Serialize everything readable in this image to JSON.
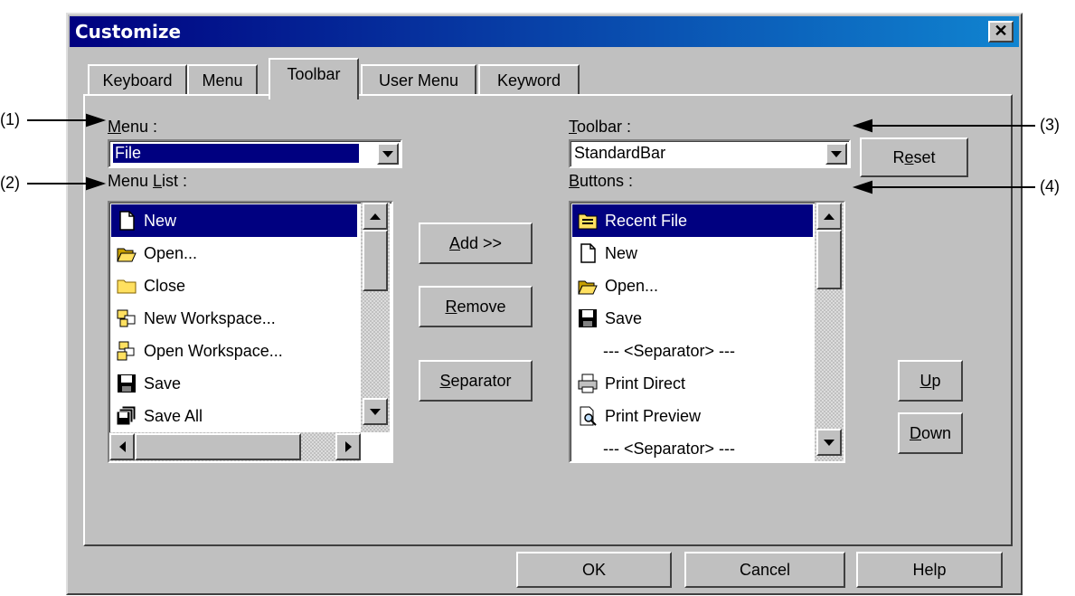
{
  "dialog": {
    "title": "Customize",
    "close_glyph": "✕"
  },
  "tabs": [
    {
      "label": "Keyboard",
      "active": false
    },
    {
      "label": "Menu",
      "active": false
    },
    {
      "label": "Toolbar",
      "active": true
    },
    {
      "label": "User Menu",
      "active": false
    },
    {
      "label": "Keyword",
      "active": false
    }
  ],
  "left": {
    "menu_label_mn": "M",
    "menu_label_rest": "enu :",
    "menu_value": "File",
    "menu_list_label_pre": "Menu ",
    "menu_list_label_mn": "L",
    "menu_list_label_post": "ist :",
    "items": [
      {
        "label": "New",
        "icon": "new-document-icon",
        "selected": true
      },
      {
        "label": "Open...",
        "icon": "open-folder-icon",
        "selected": false
      },
      {
        "label": "Close",
        "icon": "folder-icon",
        "selected": false
      },
      {
        "label": "New Workspace...",
        "icon": "new-workspace-icon",
        "selected": false
      },
      {
        "label": "Open Workspace...",
        "icon": "open-workspace-icon",
        "selected": false
      },
      {
        "label": "Save",
        "icon": "floppy-disk-icon",
        "selected": false
      },
      {
        "label": "Save All",
        "icon": "save-all-icon",
        "selected": false
      }
    ]
  },
  "middle": {
    "add_mn": "A",
    "add_rest": "dd >>",
    "remove_mn": "R",
    "remove_rest": "emove",
    "separator_mn": "S",
    "separator_rest": "eparator"
  },
  "right": {
    "toolbar_label_mn": "T",
    "toolbar_label_rest": "oolbar :",
    "toolbar_value": "StandardBar",
    "reset_pre": "R",
    "reset_mn": "e",
    "reset_post": "set",
    "buttons_label_mn": "B",
    "buttons_label_rest": "uttons :",
    "items": [
      {
        "label": "Recent File",
        "icon": "recent-file-icon",
        "selected": true
      },
      {
        "label": "New",
        "icon": "new-document-icon",
        "selected": false
      },
      {
        "label": "Open...",
        "icon": "open-folder-icon",
        "selected": false
      },
      {
        "label": "Save",
        "icon": "floppy-disk-icon",
        "selected": false
      },
      {
        "label": "--- <Separator> ---",
        "icon": "",
        "selected": false
      },
      {
        "label": "Print Direct",
        "icon": "printer-icon",
        "selected": false
      },
      {
        "label": "Print Preview",
        "icon": "print-preview-icon",
        "selected": false
      },
      {
        "label": "--- <Separator> ---",
        "icon": "",
        "selected": false
      }
    ],
    "up_mn": "U",
    "up_rest": "p",
    "down_mn": "D",
    "down_rest": "own"
  },
  "footer": {
    "ok": "OK",
    "cancel": "Cancel",
    "help": "Help"
  },
  "annotations": {
    "a1": "(1)",
    "a2": "(2)",
    "a3": "(3)",
    "a4": "(4)"
  }
}
